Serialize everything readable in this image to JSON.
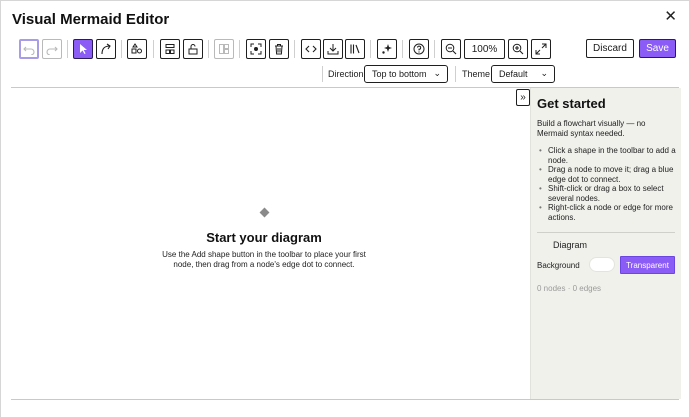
{
  "window": {
    "title": "Visual Mermaid Editor",
    "close_glyph": "✕"
  },
  "toolbar": {
    "buttons": [
      {
        "name": "undo-button",
        "icon": "undo-icon",
        "glyph": "↶"
      },
      {
        "name": "redo-button",
        "icon": "redo-icon",
        "glyph": "↷"
      },
      {
        "name": "select-tool-button",
        "icon": "pointer-icon",
        "glyph": "↖"
      },
      {
        "name": "connect-tool-button",
        "icon": "curve-arrow-icon",
        "glyph": "↗"
      },
      {
        "name": "add-shape-button",
        "icon": "shapes-icon",
        "glyph": "⬡"
      },
      {
        "name": "align-button",
        "icon": "layout-icon",
        "glyph": "▤"
      },
      {
        "name": "lock-button",
        "icon": "unlock-icon",
        "glyph": "🔓"
      },
      {
        "name": "group-button",
        "icon": "group-icon",
        "glyph": "▥"
      },
      {
        "name": "fit-selection-button",
        "icon": "focus-icon",
        "glyph": "⌖"
      },
      {
        "name": "delete-button",
        "icon": "trash-icon",
        "glyph": "🗑"
      },
      {
        "name": "code-button",
        "icon": "code-icon",
        "glyph": "<>"
      },
      {
        "name": "export-button",
        "icon": "download-icon",
        "glyph": "⤓"
      },
      {
        "name": "library-button",
        "icon": "library-icon",
        "glyph": "|||"
      },
      {
        "name": "auto-layout-button",
        "icon": "sparkle-icon",
        "glyph": "✦"
      },
      {
        "name": "help-button",
        "icon": "help-icon",
        "glyph": "?"
      },
      {
        "name": "zoom-out-button",
        "icon": "zoom-out-icon",
        "glyph": "−"
      },
      {
        "name": "zoom-in-button",
        "icon": "zoom-in-icon",
        "glyph": "+"
      },
      {
        "name": "fullscreen-button",
        "icon": "expand-icon",
        "glyph": "⤢"
      }
    ],
    "zoom_level": "100%",
    "discard_label": "Discard",
    "save_label": "Save",
    "direction_label": "Direction",
    "direction_value": "Top to bottom",
    "theme_label": "Theme",
    "theme_value": "Default",
    "chevron": "⌄"
  },
  "canvas": {
    "empty_title": "Start your diagram",
    "empty_body": "Use the Add shape button in the toolbar to place your first node, then drag from a node's edge dot to connect."
  },
  "sidebar": {
    "collapse_glyph": "»",
    "title": "Get started",
    "intro": "Build a flowchart visually — no Mermaid syntax needed.",
    "tips": [
      "Click a shape in the toolbar to add a node.",
      "Drag a node to move it; drag a blue edge dot to connect.",
      "Shift-click or drag a box to select several nodes.",
      "Right-click a node or edge for more actions."
    ],
    "diagram_label": "Diagram",
    "background_label": "Background",
    "transparent_label": "Transparent",
    "counts": "0 nodes · 0 edges"
  },
  "colors": {
    "accent": "#8b5cf6",
    "sidebar_bg": "#f1f1ec"
  }
}
